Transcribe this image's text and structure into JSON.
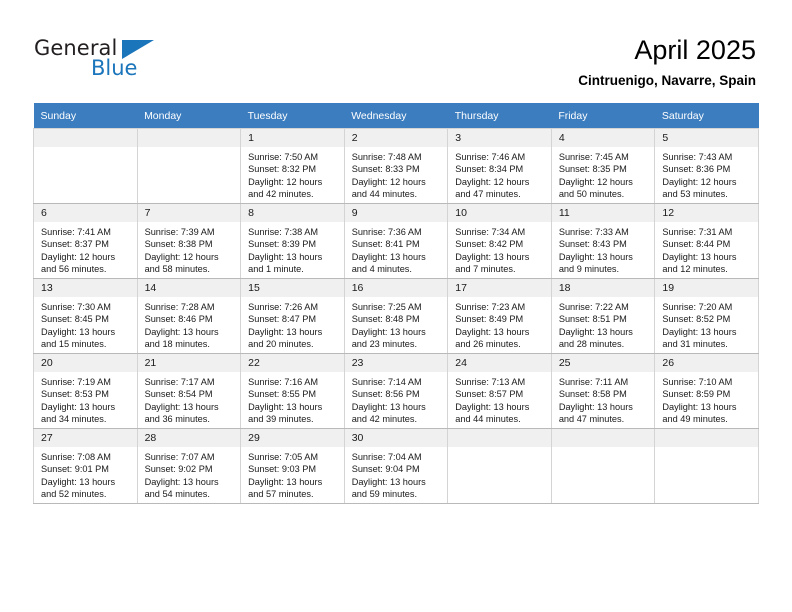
{
  "brand": {
    "name_part1": "General",
    "name_part2": "Blue",
    "triangle_icon": "triangle-icon",
    "color_blue": "#1b75bb",
    "color_dark": "#231f20"
  },
  "header": {
    "title": "April 2025",
    "subtitle": "Cintruenigo, Navarre, Spain"
  },
  "calendar": {
    "header_bg": "#3b7dbf",
    "daynum_bg": "#f0f0f0",
    "weekdays": [
      "Sunday",
      "Monday",
      "Tuesday",
      "Wednesday",
      "Thursday",
      "Friday",
      "Saturday"
    ],
    "weeks": [
      [
        {
          "day": "",
          "empty": true,
          "sunrise": "",
          "sunset": "",
          "daylight_1": "",
          "daylight_2": ""
        },
        {
          "day": "",
          "empty": true,
          "sunrise": "",
          "sunset": "",
          "daylight_1": "",
          "daylight_2": ""
        },
        {
          "day": "1",
          "empty": false,
          "sunrise": "Sunrise: 7:50 AM",
          "sunset": "Sunset: 8:32 PM",
          "daylight_1": "Daylight: 12 hours",
          "daylight_2": "and 42 minutes."
        },
        {
          "day": "2",
          "empty": false,
          "sunrise": "Sunrise: 7:48 AM",
          "sunset": "Sunset: 8:33 PM",
          "daylight_1": "Daylight: 12 hours",
          "daylight_2": "and 44 minutes."
        },
        {
          "day": "3",
          "empty": false,
          "sunrise": "Sunrise: 7:46 AM",
          "sunset": "Sunset: 8:34 PM",
          "daylight_1": "Daylight: 12 hours",
          "daylight_2": "and 47 minutes."
        },
        {
          "day": "4",
          "empty": false,
          "sunrise": "Sunrise: 7:45 AM",
          "sunset": "Sunset: 8:35 PM",
          "daylight_1": "Daylight: 12 hours",
          "daylight_2": "and 50 minutes."
        },
        {
          "day": "5",
          "empty": false,
          "sunrise": "Sunrise: 7:43 AM",
          "sunset": "Sunset: 8:36 PM",
          "daylight_1": "Daylight: 12 hours",
          "daylight_2": "and 53 minutes."
        }
      ],
      [
        {
          "day": "6",
          "empty": false,
          "sunrise": "Sunrise: 7:41 AM",
          "sunset": "Sunset: 8:37 PM",
          "daylight_1": "Daylight: 12 hours",
          "daylight_2": "and 56 minutes."
        },
        {
          "day": "7",
          "empty": false,
          "sunrise": "Sunrise: 7:39 AM",
          "sunset": "Sunset: 8:38 PM",
          "daylight_1": "Daylight: 12 hours",
          "daylight_2": "and 58 minutes."
        },
        {
          "day": "8",
          "empty": false,
          "sunrise": "Sunrise: 7:38 AM",
          "sunset": "Sunset: 8:39 PM",
          "daylight_1": "Daylight: 13 hours",
          "daylight_2": "and 1 minute."
        },
        {
          "day": "9",
          "empty": false,
          "sunrise": "Sunrise: 7:36 AM",
          "sunset": "Sunset: 8:41 PM",
          "daylight_1": "Daylight: 13 hours",
          "daylight_2": "and 4 minutes."
        },
        {
          "day": "10",
          "empty": false,
          "sunrise": "Sunrise: 7:34 AM",
          "sunset": "Sunset: 8:42 PM",
          "daylight_1": "Daylight: 13 hours",
          "daylight_2": "and 7 minutes."
        },
        {
          "day": "11",
          "empty": false,
          "sunrise": "Sunrise: 7:33 AM",
          "sunset": "Sunset: 8:43 PM",
          "daylight_1": "Daylight: 13 hours",
          "daylight_2": "and 9 minutes."
        },
        {
          "day": "12",
          "empty": false,
          "sunrise": "Sunrise: 7:31 AM",
          "sunset": "Sunset: 8:44 PM",
          "daylight_1": "Daylight: 13 hours",
          "daylight_2": "and 12 minutes."
        }
      ],
      [
        {
          "day": "13",
          "empty": false,
          "sunrise": "Sunrise: 7:30 AM",
          "sunset": "Sunset: 8:45 PM",
          "daylight_1": "Daylight: 13 hours",
          "daylight_2": "and 15 minutes."
        },
        {
          "day": "14",
          "empty": false,
          "sunrise": "Sunrise: 7:28 AM",
          "sunset": "Sunset: 8:46 PM",
          "daylight_1": "Daylight: 13 hours",
          "daylight_2": "and 18 minutes."
        },
        {
          "day": "15",
          "empty": false,
          "sunrise": "Sunrise: 7:26 AM",
          "sunset": "Sunset: 8:47 PM",
          "daylight_1": "Daylight: 13 hours",
          "daylight_2": "and 20 minutes."
        },
        {
          "day": "16",
          "empty": false,
          "sunrise": "Sunrise: 7:25 AM",
          "sunset": "Sunset: 8:48 PM",
          "daylight_1": "Daylight: 13 hours",
          "daylight_2": "and 23 minutes."
        },
        {
          "day": "17",
          "empty": false,
          "sunrise": "Sunrise: 7:23 AM",
          "sunset": "Sunset: 8:49 PM",
          "daylight_1": "Daylight: 13 hours",
          "daylight_2": "and 26 minutes."
        },
        {
          "day": "18",
          "empty": false,
          "sunrise": "Sunrise: 7:22 AM",
          "sunset": "Sunset: 8:51 PM",
          "daylight_1": "Daylight: 13 hours",
          "daylight_2": "and 28 minutes."
        },
        {
          "day": "19",
          "empty": false,
          "sunrise": "Sunrise: 7:20 AM",
          "sunset": "Sunset: 8:52 PM",
          "daylight_1": "Daylight: 13 hours",
          "daylight_2": "and 31 minutes."
        }
      ],
      [
        {
          "day": "20",
          "empty": false,
          "sunrise": "Sunrise: 7:19 AM",
          "sunset": "Sunset: 8:53 PM",
          "daylight_1": "Daylight: 13 hours",
          "daylight_2": "and 34 minutes."
        },
        {
          "day": "21",
          "empty": false,
          "sunrise": "Sunrise: 7:17 AM",
          "sunset": "Sunset: 8:54 PM",
          "daylight_1": "Daylight: 13 hours",
          "daylight_2": "and 36 minutes."
        },
        {
          "day": "22",
          "empty": false,
          "sunrise": "Sunrise: 7:16 AM",
          "sunset": "Sunset: 8:55 PM",
          "daylight_1": "Daylight: 13 hours",
          "daylight_2": "and 39 minutes."
        },
        {
          "day": "23",
          "empty": false,
          "sunrise": "Sunrise: 7:14 AM",
          "sunset": "Sunset: 8:56 PM",
          "daylight_1": "Daylight: 13 hours",
          "daylight_2": "and 42 minutes."
        },
        {
          "day": "24",
          "empty": false,
          "sunrise": "Sunrise: 7:13 AM",
          "sunset": "Sunset: 8:57 PM",
          "daylight_1": "Daylight: 13 hours",
          "daylight_2": "and 44 minutes."
        },
        {
          "day": "25",
          "empty": false,
          "sunrise": "Sunrise: 7:11 AM",
          "sunset": "Sunset: 8:58 PM",
          "daylight_1": "Daylight: 13 hours",
          "daylight_2": "and 47 minutes."
        },
        {
          "day": "26",
          "empty": false,
          "sunrise": "Sunrise: 7:10 AM",
          "sunset": "Sunset: 8:59 PM",
          "daylight_1": "Daylight: 13 hours",
          "daylight_2": "and 49 minutes."
        }
      ],
      [
        {
          "day": "27",
          "empty": false,
          "sunrise": "Sunrise: 7:08 AM",
          "sunset": "Sunset: 9:01 PM",
          "daylight_1": "Daylight: 13 hours",
          "daylight_2": "and 52 minutes."
        },
        {
          "day": "28",
          "empty": false,
          "sunrise": "Sunrise: 7:07 AM",
          "sunset": "Sunset: 9:02 PM",
          "daylight_1": "Daylight: 13 hours",
          "daylight_2": "and 54 minutes."
        },
        {
          "day": "29",
          "empty": false,
          "sunrise": "Sunrise: 7:05 AM",
          "sunset": "Sunset: 9:03 PM",
          "daylight_1": "Daylight: 13 hours",
          "daylight_2": "and 57 minutes."
        },
        {
          "day": "30",
          "empty": false,
          "sunrise": "Sunrise: 7:04 AM",
          "sunset": "Sunset: 9:04 PM",
          "daylight_1": "Daylight: 13 hours",
          "daylight_2": "and 59 minutes."
        },
        {
          "day": "",
          "empty": true,
          "sunrise": "",
          "sunset": "",
          "daylight_1": "",
          "daylight_2": ""
        },
        {
          "day": "",
          "empty": true,
          "sunrise": "",
          "sunset": "",
          "daylight_1": "",
          "daylight_2": ""
        },
        {
          "day": "",
          "empty": true,
          "sunrise": "",
          "sunset": "",
          "daylight_1": "",
          "daylight_2": ""
        }
      ]
    ]
  }
}
